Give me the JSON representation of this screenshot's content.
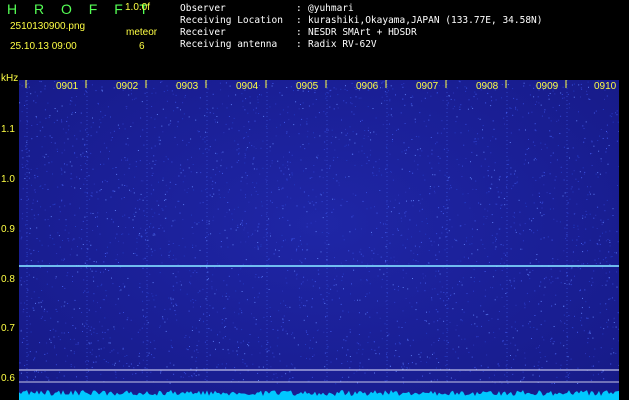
{
  "header": {
    "brand": "H R O F F T",
    "version": "1.0.0f",
    "filename": "2510130900.png",
    "datetime": "25.10.13 09:00",
    "meteor_label": "meteor",
    "meteor_count": "6"
  },
  "info": [
    {
      "key": "Observer",
      "value": "@yuhmari"
    },
    {
      "key": "Receiving Location",
      "value": "kurashiki,Okayama,JAPAN (133.77E, 34.58N)"
    },
    {
      "key": "Receiver",
      "value": "NESDR SMArt + HDSDR"
    },
    {
      "key": "Receiving antenna",
      "value": "Radix RV-62V"
    }
  ],
  "axis": {
    "unit": "kHz",
    "y_ticks": [
      "1.1",
      "1.0",
      "0.9",
      "0.8",
      "0.7",
      "0.6"
    ],
    "time_labels": [
      "0901",
      "0902",
      "0903",
      "0904",
      "0905",
      "0906",
      "0907",
      "0908",
      "0909",
      "0910"
    ]
  },
  "colors": {
    "background": "#1a1f96",
    "label": "#ffff44",
    "brand": "#55ff55",
    "signal": "#7fd8ff",
    "noise_floor": "#00c8ff"
  }
}
